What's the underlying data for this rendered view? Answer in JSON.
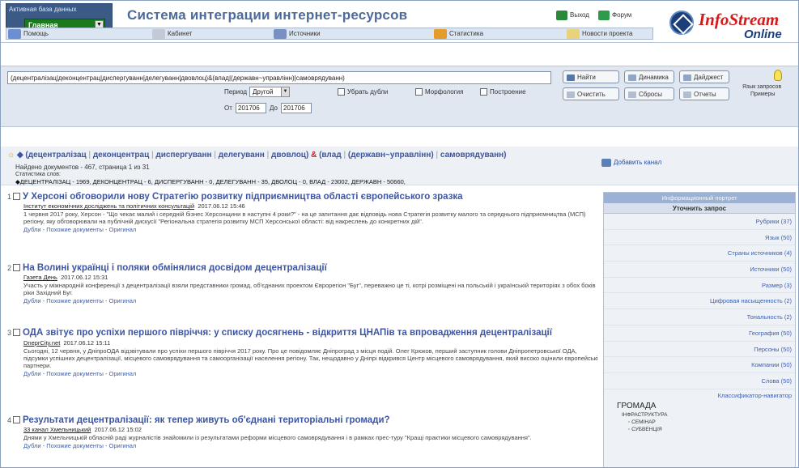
{
  "header": {
    "db_label": "Активная база данных",
    "db_value": "Главная",
    "app_title": "Система интеграции интернет-ресурсов",
    "exit_label": "Выход",
    "forum_label": "Форум",
    "logo_line1": "InfoStream",
    "logo_line2": "Online",
    "nav": [
      {
        "label": "Помощь"
      },
      {
        "label": "Кабинет"
      },
      {
        "label": "Источники"
      },
      {
        "label": "Статистика"
      },
      {
        "label": "Новости проекта"
      }
    ]
  },
  "search": {
    "query": "(децентралізац|деконцентрац|диспергуванн|делегуванн|двовлоц)&(влад|(державн~управлінн)|самоврядуванн)",
    "period_label": "Период",
    "period_value": "Другой",
    "from_label": "От",
    "from_value": "201706",
    "to_label": "До",
    "to_value": "201706",
    "option1": "Убрать дубли",
    "option2": "Морфология",
    "option3": "Построение",
    "buttons": {
      "find": "Найти",
      "dynamics": "Динамика",
      "digest": "Дайджест",
      "clear": "Очистить",
      "save": "Сбросы",
      "reports": "Отчеты"
    },
    "hints_line1": "Язык запросов",
    "hints_line2": "Примеры"
  },
  "query_display": {
    "terms_a": [
      "децентралізац",
      "деконцентрац",
      "диспергуванн",
      "делегуванн",
      "двовлоц"
    ],
    "amp": "&",
    "terms_b": [
      "влад",
      "(державн~управлінн)",
      "самоврядуванн"
    ],
    "found_text": "Найдено документов - 467, страница 1 из 31",
    "stat_label": "Статистика слов:",
    "stat_line": "◆ДЕЦЕНТРАЛІЗАЦ - 1969, ДЕКОНЦЕНТРАЦ - 6, ДИСПЕРГУВАНН - 0, ДЕЛЕГУВАНН - 35, ДВОЛОЦ - 0, ВЛАД - 23002, ДЕРЖАВН - 50660,",
    "add_channel": "Добавить канал"
  },
  "results": [
    {
      "num": "1",
      "title": "У Херсоні обговорили нову Стратегію розвитку підприємництва області європейського зразка",
      "source": "Інститут економічних досліджень та політичних консультацій",
      "date": "2017.06.12 15:46",
      "snippet": "1 червня 2017 року, Херсон - \"Що чекає малий і середній бізнес Херсонщини в наступні 4 роки?\" - на це запитання дає відповідь нова Стратегія розвитку малого та середнього підприємництва (МСП) регіону, яку обговорювали на публічній дискусії \"Регіональна стратегія розвитку МСП Херсонської області: від накреслень до конкретних дій\".",
      "links": "Дубли - Похожие документы - Оригинал"
    },
    {
      "num": "2",
      "title": "На Волині українці і поляки обмінялися досвідом децентралізації",
      "source": "Газета День",
      "date": "2017.06.12 15:31",
      "snippet": "Участь у міжнародній конференції з децентралізації взяли представники громад, об'єднаних проектом Єврорегіон \"Буг\", переважно це ті, котрі розміщені на польській і українській територіях з обох боків ріки Західний Буг.",
      "links": "Дубли - Похожие документы - Оригинал"
    },
    {
      "num": "3",
      "title": "ОДА звітує про успіхи першого півріччя: у списку досягнень - відкриття ЦНАПів та впровадження децентралізації",
      "source": "DneprCity.net",
      "date": "2017.06.12 15:11",
      "snippet": "Сьогодні, 12 червня, у ДніпроОДА відзвітували про успіхи першого півріччя 2017 року. Про це повідомляє Дніпроград з місця подій. Олег Крюков, перший заступник голови Дніпропетровської ОДА, підсумки успішних децентралізації, місцевого самоврядування та самоорганізації населення регіону. Так, нещодавно у Дніпрі відкрився Центр місцевого самоврядування, який високо оцінили європейські партнери.",
      "links": "Дубли - Похожие документы - Оригинал"
    },
    {
      "num": "4",
      "title": "Результати децентралізації: як тепер живуть об'єднані територіальні громади?",
      "source": "33 канал Хмельницький",
      "date": "2017.06.12 15:02",
      "snippet": "Днями у Хмельницькій обласній раді журналістів знайомили із результатами реформи місцевого самоврядування і в рамках прес-туру \"Кращі практики місцевого самоврядування\".",
      "links": "Дубли - Похожие документы - Оригинал"
    }
  ],
  "panel": {
    "header": "Информационный портрет",
    "subheader": "Уточнить запрос",
    "facets": [
      "Рубрики (37)",
      "Язык (50)",
      "Страны источников (4)",
      "Источники (50)",
      "Размер (3)",
      "Цифровая насыщенность (2)",
      "Тональность (2)",
      "География (50)",
      "Персоны (50)",
      "Компании (50)",
      "Слова (50)"
    ],
    "classifier": "Классификатор-навигатор",
    "tree_root": "ГРОМАДА",
    "tree_l1": "ІНФРАСТРУКТУРА",
    "tree_l2a": "СЕМІНАР",
    "tree_l2b": "СУБВЕНЦІЯ"
  }
}
